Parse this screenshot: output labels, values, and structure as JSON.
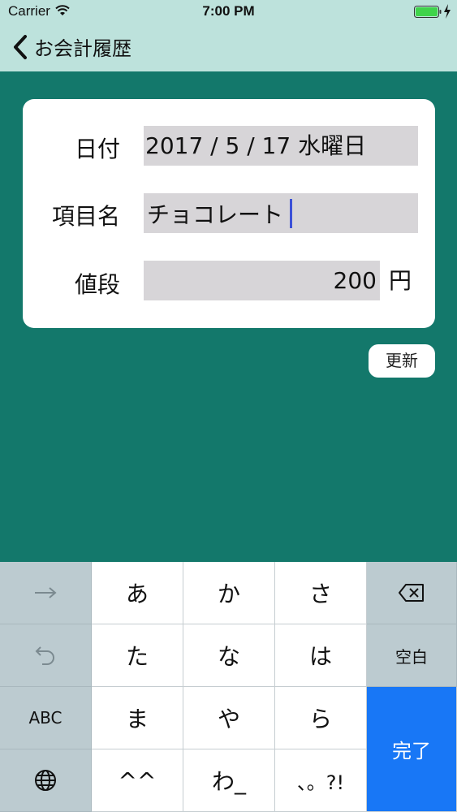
{
  "status_bar": {
    "carrier": "Carrier",
    "time": "7:00 PM"
  },
  "nav": {
    "back_title": "お会計履歴"
  },
  "form": {
    "date_label": "日付",
    "date_value": "2017 / 5 / 17  水曜日",
    "item_label": "項目名",
    "item_value": "チョコレート",
    "price_label": "値段",
    "price_value": "200",
    "price_unit": "円"
  },
  "update_button": "更新",
  "keyboard": {
    "row1": [
      "あ",
      "か",
      "さ"
    ],
    "row2": [
      "た",
      "な",
      "は"
    ],
    "row3": [
      "ま",
      "や",
      "ら"
    ],
    "row4": [
      "^^",
      "わ_",
      "、。?!"
    ],
    "abc": "ABC",
    "space": "空白",
    "done": "完了"
  },
  "colors": {
    "background": "#13786b",
    "nav_bar": "#bde2dc",
    "field": "#d7d5d8",
    "done_key": "#1877f6",
    "caret": "#3c52d8"
  }
}
